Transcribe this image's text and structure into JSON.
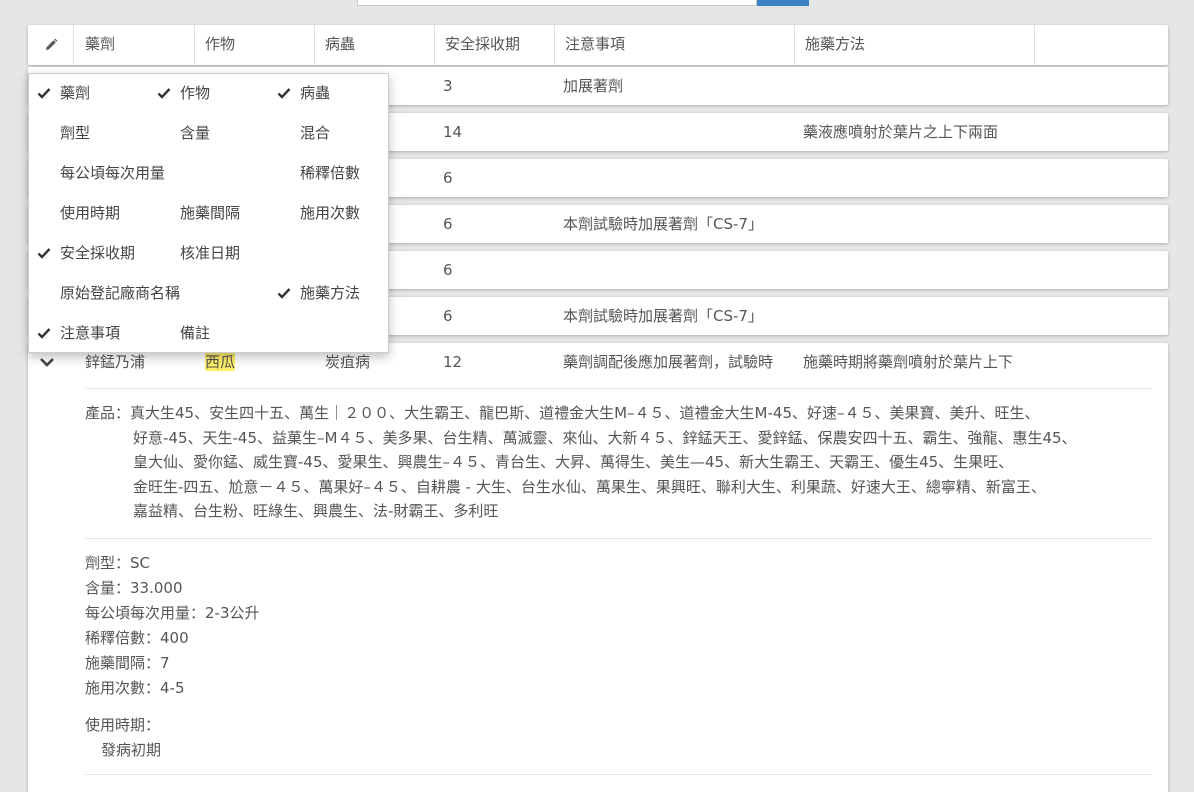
{
  "header": {
    "columns": [
      "藥劑",
      "作物",
      "病蟲",
      "安全採收期",
      "注意事項",
      "施藥方法"
    ]
  },
  "rows": [
    {
      "safe": "3",
      "note": "加展著劑",
      "method": ""
    },
    {
      "safe": "14",
      "note": "",
      "method": "藥液應噴射於葉片之上下兩面"
    },
    {
      "safe": "6",
      "note": "",
      "method": ""
    },
    {
      "safe": "6",
      "note": "本劑試驗時加展著劑「CS-7」",
      "method": ""
    },
    {
      "safe": "6",
      "note": "",
      "method": ""
    },
    {
      "safe": "6",
      "note": "本劑試驗時加展著劑「CS-7」",
      "method": ""
    }
  ],
  "expanded": {
    "drug": "鋅錳乃浦",
    "crop": "西瓜",
    "pest": "炭疽病",
    "safe": "12",
    "note": "藥劑調配後應加展著劑，試驗時",
    "method": "施藥時期將藥劑噴射於葉片上下",
    "products_label": "產品：",
    "products_lines": [
      "真大生45、安生四十五、萬生｜２００、大生霸王、龍巴斯、道禮金大生M–４５、道禮金大生M-45、好速–４５、美果寶、美升、旺生、",
      "好意-45、天生-45、益菓生–M４５、美多果、台生精、萬滅靈、來仙、大新４５、鋅錳天王、愛鋅錳、保農安四十五、霸生、強龍、惠生45、",
      "皇大仙、愛你錳、威生寶-45、愛果生、興農生–４５、青台生、大昇、萬得生、美生—45、新大生霸王、天霸王、優生45、生果旺、",
      "金旺生-四五、尬意－４５、萬果好–４５、自耕農 - 大生、台生水仙、萬果生、果興旺、聯利大生、利果蔬、好速大王、總寧精、新富王、",
      "嘉益精、台生粉、旺綠生、興農生、法-財霸王、多利旺"
    ],
    "details": [
      "劑型：SC",
      "含量：33.000",
      "每公頃每次用量：2-3公升",
      "稀釋倍數：400",
      "施藥間隔：7",
      "施用次數：4-5"
    ],
    "usage_label": "使用時期：",
    "usage_value": "發病初期"
  },
  "column_menu": {
    "options": [
      {
        "label": "藥劑",
        "checked": true
      },
      {
        "label": "作物",
        "checked": true
      },
      {
        "label": "病蟲",
        "checked": true
      },
      {
        "label": "劑型",
        "checked": false
      },
      {
        "label": "含量",
        "checked": false
      },
      {
        "label": "混合",
        "checked": false
      },
      {
        "label": "每公頃每次用量",
        "checked": false
      },
      {
        "label": "稀釋倍數",
        "checked": false
      },
      {
        "label": "使用時期",
        "checked": false
      },
      {
        "label": "施藥間隔",
        "checked": false
      },
      {
        "label": "施用次數",
        "checked": false
      },
      {
        "label": "安全採收期",
        "checked": true
      },
      {
        "label": "核准日期",
        "checked": false
      },
      {
        "label": "原始登記廠商名稱",
        "checked": false
      },
      {
        "label": "施藥方法",
        "checked": true
      },
      {
        "label": "注意事項",
        "checked": true
      },
      {
        "label": "備註",
        "checked": false
      }
    ]
  },
  "colors": {
    "highlight": "#ffee66",
    "background": "#e6e6e6"
  }
}
